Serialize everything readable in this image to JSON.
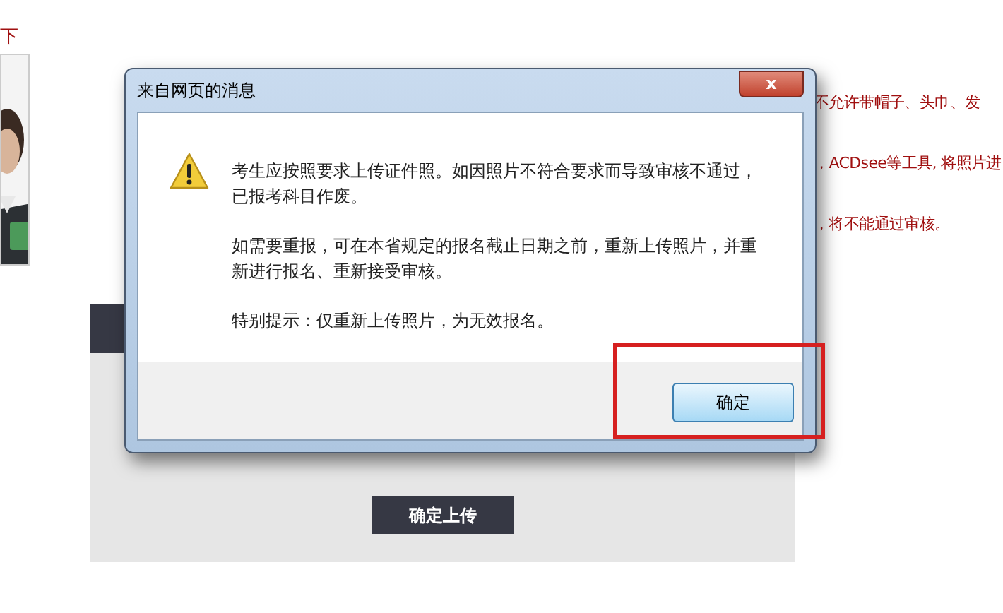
{
  "page": {
    "side_label": "下",
    "requirements": [
      "不允许带帽子、头巾、发",
      "，ACDsee等工具, 将照片进",
      "，将不能通过审核。"
    ],
    "upload_button": "确定上传"
  },
  "dialog": {
    "title": "来自网页的消息",
    "close_button": "x",
    "paragraphs": [
      "考生应按照要求上传证件照。如因照片不符合要求而导致审核不通过，已报考科目作废。",
      "如需要重报，可在本省规定的报名截止日期之前，重新上传照片，并重新进行报名、重新接受审核。",
      "特别提示：仅重新上传照片，为无效报名。"
    ],
    "ok_button": "确定",
    "ok_highlighted": true
  }
}
